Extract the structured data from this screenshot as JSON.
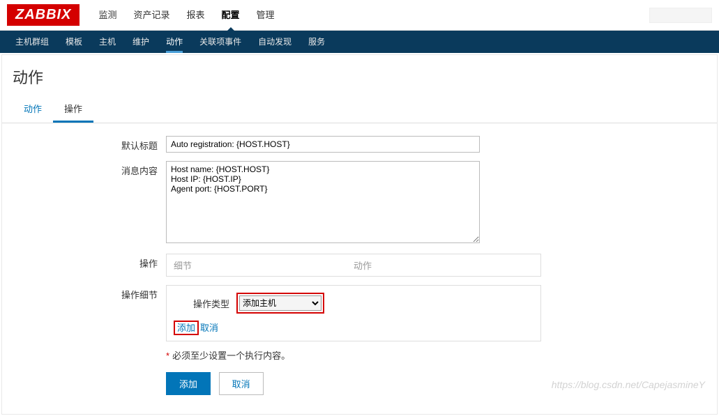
{
  "logo": "ZABBIX",
  "topNav": {
    "items": [
      {
        "label": "监测"
      },
      {
        "label": "资产记录"
      },
      {
        "label": "报表"
      },
      {
        "label": "配置",
        "active": true
      },
      {
        "label": "管理"
      }
    ]
  },
  "subNav": {
    "items": [
      {
        "label": "主机群组"
      },
      {
        "label": "模板"
      },
      {
        "label": "主机"
      },
      {
        "label": "维护"
      },
      {
        "label": "动作",
        "active": true
      },
      {
        "label": "关联项事件"
      },
      {
        "label": "自动发现"
      },
      {
        "label": "服务"
      }
    ]
  },
  "pageTitle": "动作",
  "tabs": {
    "items": [
      {
        "label": "动作"
      },
      {
        "label": "操作",
        "active": true
      }
    ]
  },
  "form": {
    "defaultTitle": {
      "label": "默认标题",
      "value": "Auto registration: {HOST.HOST}"
    },
    "messageContent": {
      "label": "消息内容",
      "value": "Host name: {HOST.HOST}\nHost IP: {HOST.IP}\nAgent port: {HOST.PORT}"
    },
    "operations": {
      "label": "操作",
      "col1": "细节",
      "col2": "动作"
    },
    "operationDetail": {
      "label": "操作细节",
      "typeLabel": "操作类型",
      "typeValue": "添加主机",
      "addLink": "添加",
      "cancelLink": "取消"
    },
    "requiredNote": "必须至少设置一个执行内容。",
    "addButton": "添加",
    "cancelButton": "取消"
  },
  "watermark": "https://blog.csdn.net/CapejasmineY"
}
